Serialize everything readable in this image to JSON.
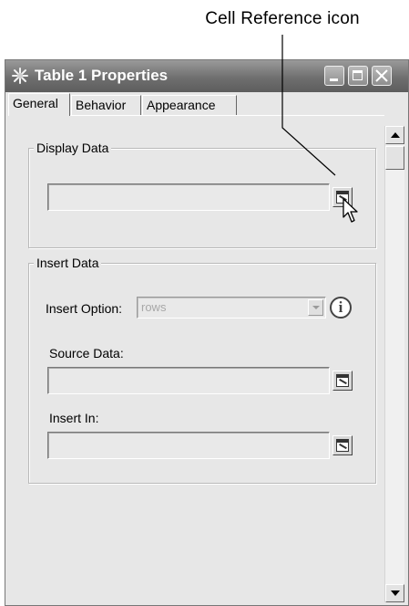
{
  "callout": {
    "label": "Cell Reference icon"
  },
  "window": {
    "title": "Table 1 Properties",
    "tabs": [
      {
        "label": "General"
      },
      {
        "label": "Behavior"
      },
      {
        "label": "Appearance"
      }
    ]
  },
  "display_data": {
    "label": "Display Data",
    "value": ""
  },
  "insert_data": {
    "label": "Insert Data",
    "insert_option": {
      "label": "Insert Option:",
      "value": "rows"
    },
    "source_data": {
      "label": "Source Data:",
      "value": ""
    },
    "insert_in": {
      "label": "Insert In:",
      "value": ""
    }
  }
}
